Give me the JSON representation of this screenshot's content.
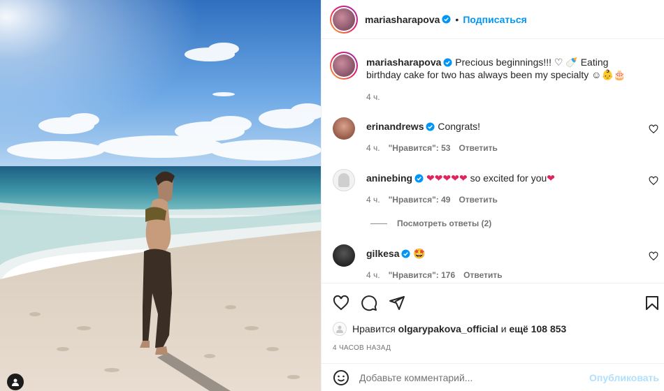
{
  "header": {
    "username": "mariasharapova",
    "separator": "•",
    "follow_label": "Подписаться"
  },
  "caption": {
    "username": "mariasharapova",
    "text_part1": "Precious beginnings!!! ",
    "text_part2": " Eating birthday cake for two has always been my specialty ",
    "time": "4 ч."
  },
  "comments": [
    {
      "username": "erinandrews",
      "text": "Congrats!",
      "time": "4 ч.",
      "likes": "\"Нравится\": 53",
      "reply": "Ответить"
    },
    {
      "username": "aninebing",
      "text": "so excited for you",
      "time": "4 ч.",
      "likes": "\"Нравится\": 49",
      "reply": "Ответить"
    },
    {
      "username": "gilkesa",
      "text": "",
      "time": "4 ч.",
      "likes": "\"Нравится\": 176",
      "reply": "Ответить"
    }
  ],
  "view_replies": "Посмотреть ответы (2)",
  "likes_summary": {
    "prefix": "Нравится",
    "user": "olgarypakova_official",
    "conj": "и",
    "rest": "ещё 108 853"
  },
  "post_time": "4 ЧАСОВ НАЗАД",
  "add_comment": {
    "placeholder": "Добавьте комментарий...",
    "publish_label": "Опубликовать"
  },
  "icons": {
    "like": "heart-icon",
    "comment": "comment-icon",
    "share": "send-icon",
    "save": "bookmark-icon",
    "emoji": "smiley-icon",
    "tag": "user-tag-icon"
  },
  "colors": {
    "accent": "#0095f6",
    "accent_disabled": "#b2dffc",
    "text": "#262626",
    "muted": "#737373",
    "heart": "#ed4956"
  }
}
